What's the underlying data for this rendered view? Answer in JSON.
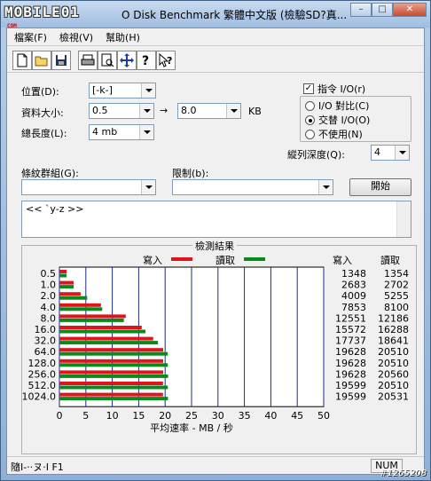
{
  "window": {
    "logo": "MOBILE01",
    "logo_sub": "COM",
    "title": "O Disk Benchmark  繁體中文版 (檢驗SD?真...",
    "min": "–",
    "max": "□",
    "close": "✕"
  },
  "menu": [
    "檔案(F)",
    "檢視(V)",
    "幫助(H)"
  ],
  "toolbar_icons": [
    "new-icon",
    "open-icon",
    "save-icon",
    "print-icon",
    "print-preview-icon",
    "move-icon",
    "help-icon",
    "context-help-icon"
  ],
  "form": {
    "position_label": "位置(D):",
    "position_value": "[-k-]",
    "size_label": "資料大小:",
    "size_from": "0.5",
    "arrow": "→",
    "size_to": "8.0",
    "size_unit": "KB",
    "total_label": "總長度(L):",
    "total_value": "4 mb",
    "queue_label": "縱列深度(Q):",
    "queue_value": "4",
    "pattern_label": "條紋群組(G):",
    "pattern_value": "",
    "limit_label": "限制(b):",
    "limit_value": "",
    "start_button": "開始",
    "direct_io_label": "指令 I/O(r)",
    "direct_io_checked": true,
    "io_compare_label": "I/O 對比(C)",
    "overlapped_label": "交替 I/O(O)",
    "disable_label": "不使用(N)",
    "selected_io_mode": "overlapped",
    "log_text": "<< `y-z >>"
  },
  "results": {
    "title": "檢測結果",
    "write_legend": "寫入",
    "read_legend": "讀取",
    "col_write": "寫入",
    "col_read": "讀取",
    "write_color": "#e0141e",
    "read_color": "#0a8a1a",
    "xlabel": "平均速率 - MB / 秒"
  },
  "chart_data": {
    "type": "bar",
    "orientation": "horizontal",
    "categories": [
      "0.5",
      "1.0",
      "2.0",
      "4.0",
      "8.0",
      "16.0",
      "32.0",
      "64.0",
      "128.0",
      "256.0",
      "512.0",
      "1024.0"
    ],
    "series": [
      {
        "name": "寫入",
        "values": [
          1348,
          2683,
          4009,
          7853,
          12551,
          15572,
          17737,
          19628,
          19628,
          19628,
          19599,
          19599
        ]
      },
      {
        "name": "讀取",
        "values": [
          1354,
          2702,
          5255,
          8100,
          12186,
          16288,
          18641,
          20510,
          20510,
          20560,
          20510,
          20531
        ]
      }
    ],
    "value_units": "KB/s",
    "xlabel": "平均速率 - MB / 秒",
    "xlim": [
      0,
      50
    ],
    "xticks": [
      0,
      5,
      10,
      15,
      20,
      25,
      30,
      35,
      40,
      45,
      50
    ],
    "grid": true
  },
  "status": {
    "left_text": "隨I-··ヌ·I F1",
    "num_indicator": "NUM"
  },
  "watermark": "#1265208"
}
